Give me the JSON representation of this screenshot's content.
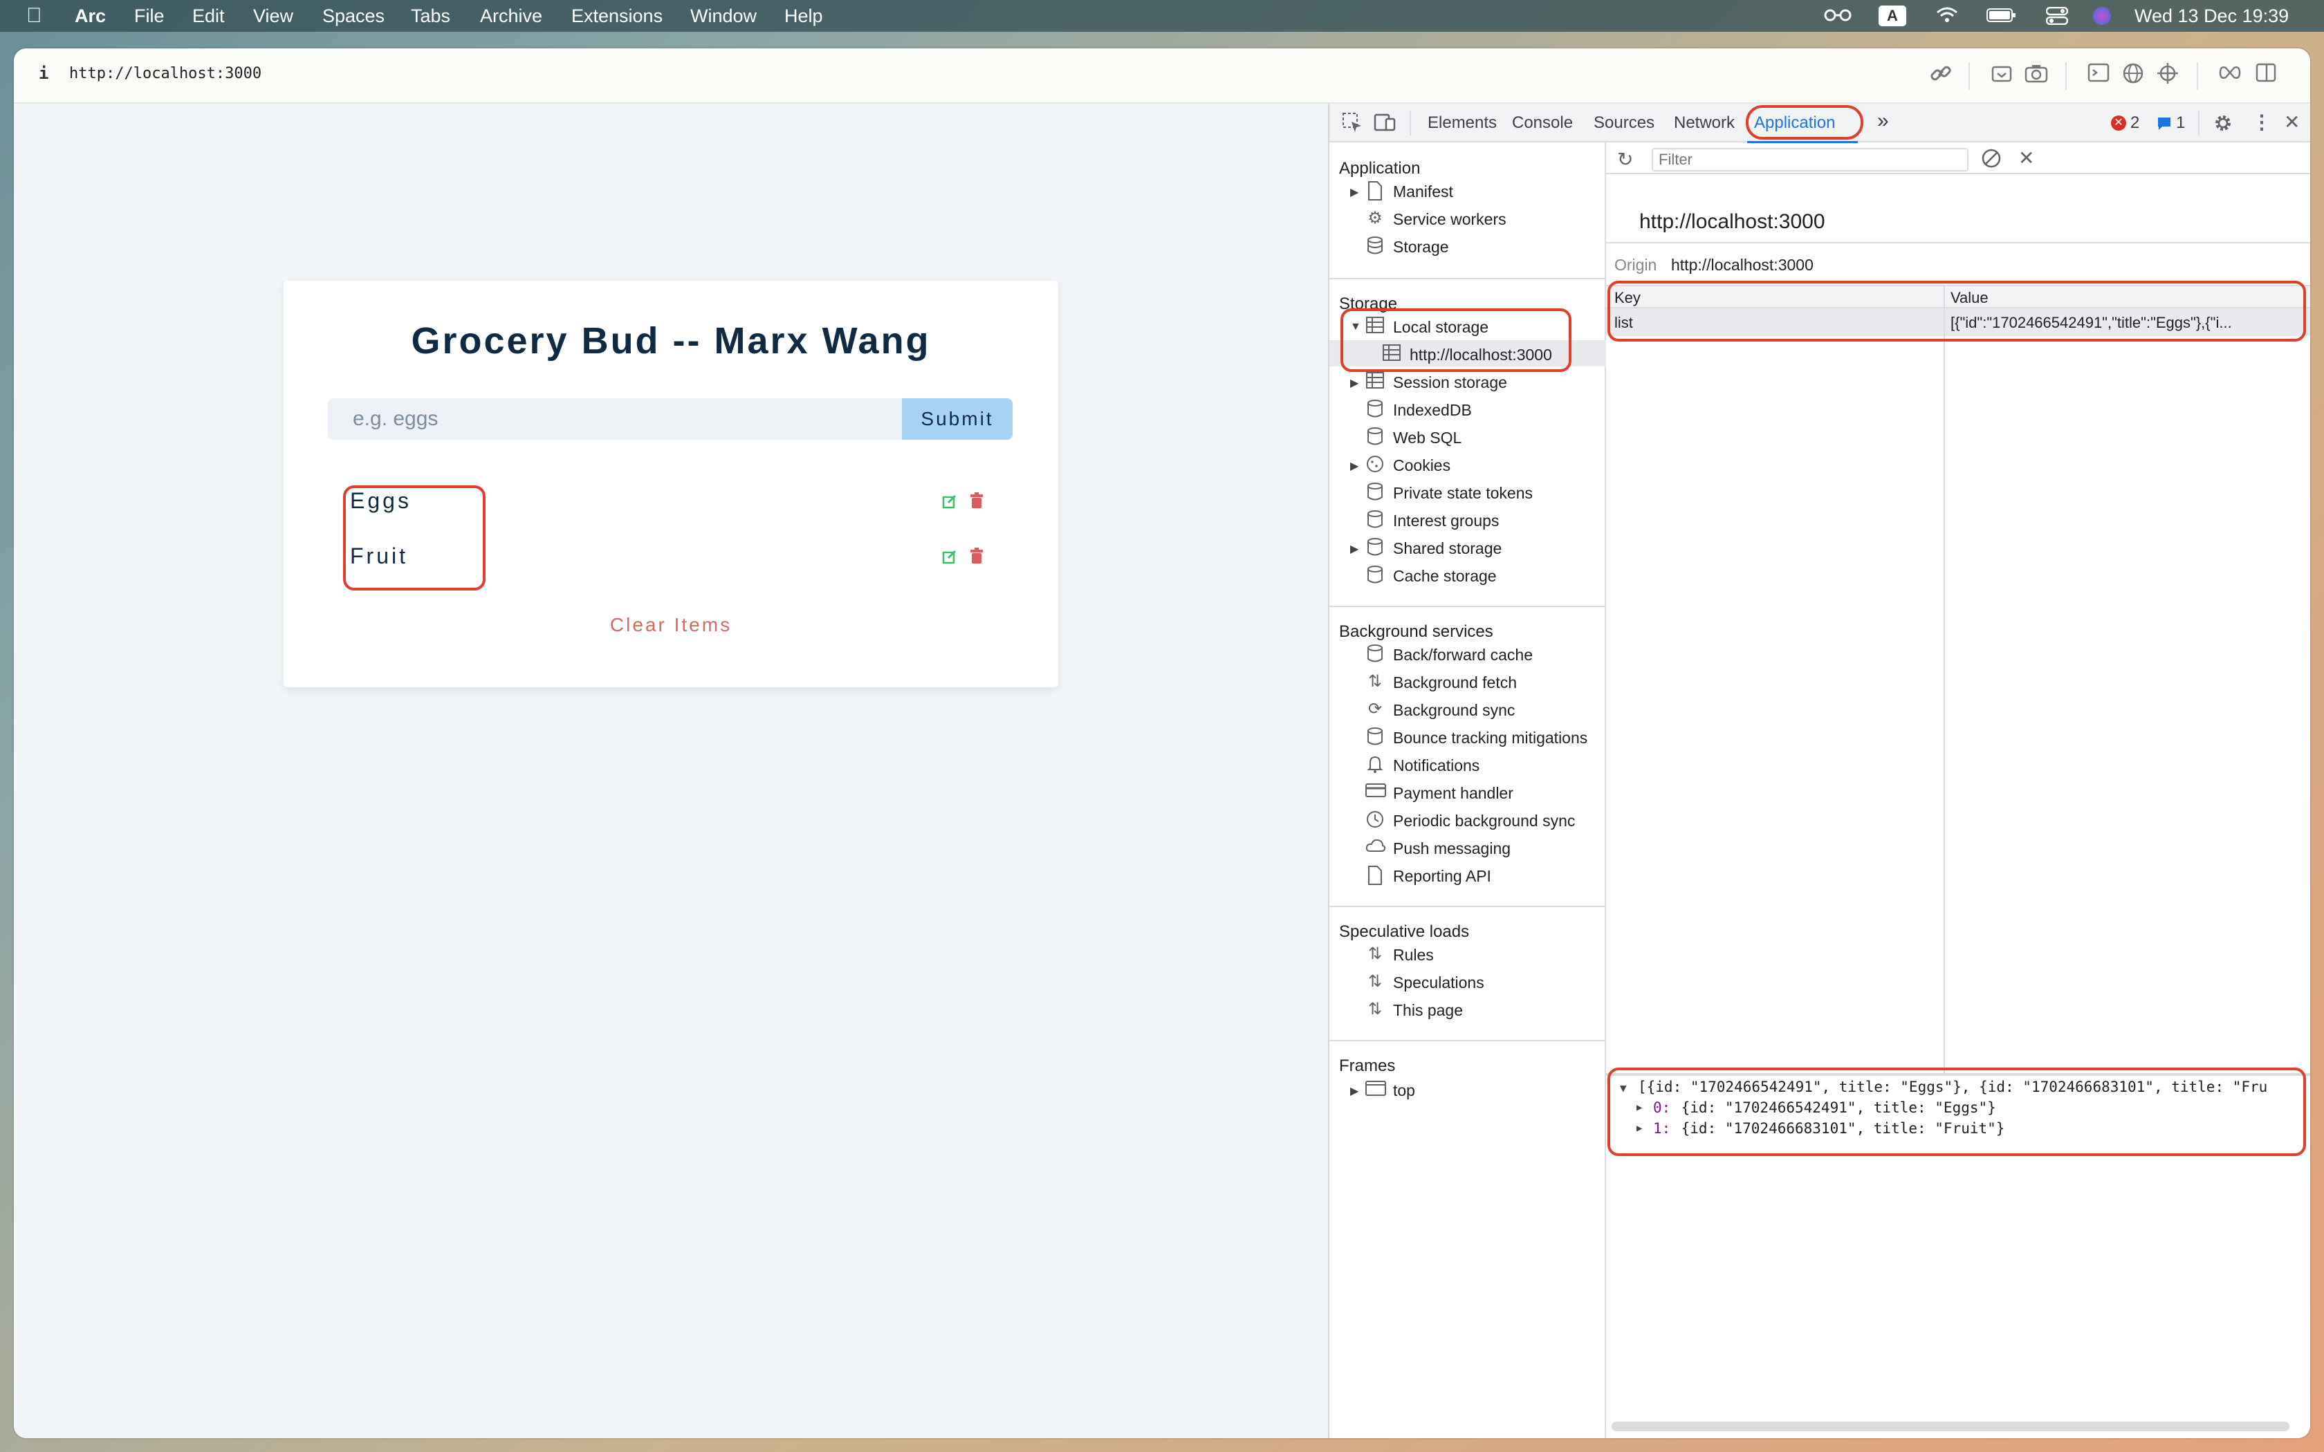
{
  "menubar": {
    "app": "Arc",
    "items": [
      "File",
      "Edit",
      "View",
      "Spaces",
      "Tabs",
      "Archive",
      "Extensions",
      "Window",
      "Help"
    ],
    "keyboard_label": "A",
    "datetime": "Wed 13 Dec  19:39"
  },
  "browser": {
    "info_glyph": "i",
    "url": "http://localhost:3000"
  },
  "app": {
    "title": "Grocery Bud -- Marx Wang",
    "input_placeholder": "e.g. eggs",
    "submit_label": "Submit",
    "items": [
      "Eggs",
      "Fruit"
    ],
    "clear_label": "Clear Items"
  },
  "devtools": {
    "tabs": [
      "Elements",
      "Console",
      "Sources",
      "Network",
      "Application"
    ],
    "active_tab": "Application",
    "error_count": "2",
    "message_count": "1",
    "sidebar": {
      "application_heading": "Application",
      "application_items": [
        "Manifest",
        "Service workers",
        "Storage"
      ],
      "storage_heading": "Storage",
      "local_storage": "Local storage",
      "local_storage_origin": "http://localhost:3000",
      "storage_items": [
        "Session storage",
        "IndexedDB",
        "Web SQL",
        "Cookies",
        "Private state tokens",
        "Interest groups",
        "Shared storage",
        "Cache storage"
      ],
      "background_heading": "Background services",
      "background_items": [
        "Back/forward cache",
        "Background fetch",
        "Background sync",
        "Bounce tracking mitigations",
        "Notifications",
        "Payment handler",
        "Periodic background sync",
        "Push messaging",
        "Reporting API"
      ],
      "speculative_heading": "Speculative loads",
      "speculative_items": [
        "Rules",
        "Speculations",
        "This page"
      ],
      "frames_heading": "Frames",
      "frames_items": [
        "top"
      ]
    },
    "filter_placeholder": "Filter",
    "origin_title": "http://localhost:3000",
    "origin_label": "Origin",
    "origin_value": "http://localhost:3000",
    "table": {
      "headers": [
        "Key",
        "Value"
      ],
      "rows": [
        [
          "list",
          "[{\"id\":\"1702466542491\",\"title\":\"Eggs\"},{\"i..."
        ]
      ]
    },
    "preview": {
      "line0": "[{id: \"1702466542491\", title: \"Eggs\"}, {id: \"1702466683101\", title: \"Fru",
      "line1_index": "0:",
      "line1": " {id: \"1702466542491\", title: \"Eggs\"}",
      "line2_index": "1:",
      "line2": " {id: \"1702466683101\", title: \"Fruit\"}"
    }
  },
  "colors": {
    "accent": "#1a73e8",
    "highlight": "#e0402b",
    "submit": "#a8d2f3"
  }
}
